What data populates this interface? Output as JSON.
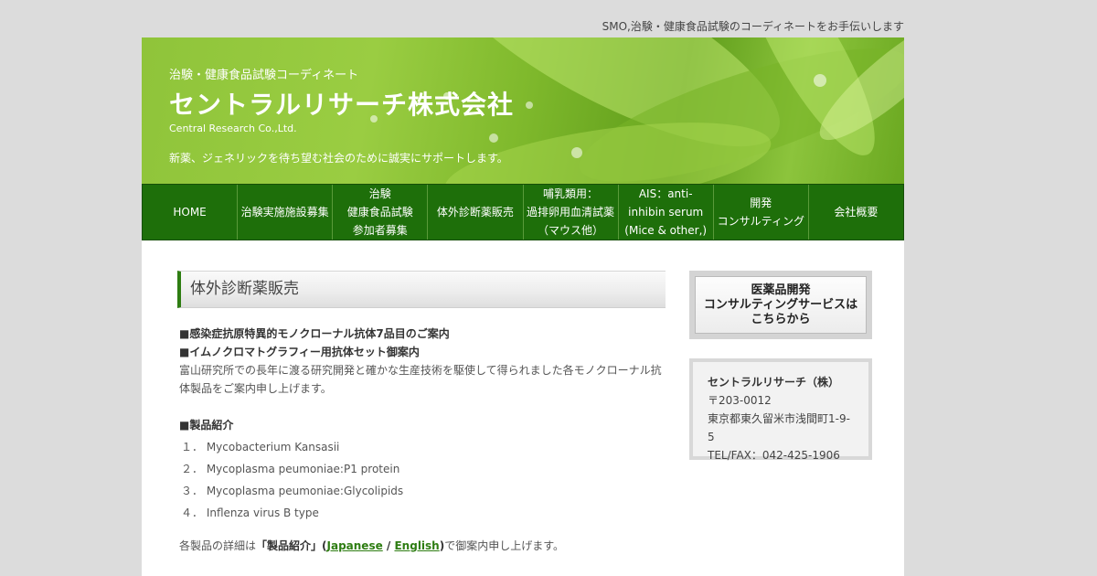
{
  "tagline": "SMO,治験・健康食品試験のコーディネートをお手伝いします",
  "header": {
    "sub": "治験・健康食品試験コーディネート",
    "title": "セントラルリサーチ株式会社",
    "en": "Central Research Co.,Ltd.",
    "message": "新薬、ジェネリックを待ち望む社会のために誠実にサポートします。"
  },
  "nav": [
    {
      "label": "HOME"
    },
    {
      "label": "治験実施施設募集"
    },
    {
      "label": "治験\n健康食品試験\n参加者募集"
    },
    {
      "label": "体外診断薬販売"
    },
    {
      "label": "哺乳類用：\n過排卵用血清試薬\n（マウス他）"
    },
    {
      "label": "AIS：anti-\ninhibin serum\n(Mice & other,)"
    },
    {
      "label": "開発\nコンサルティング"
    },
    {
      "label": "会社概要"
    }
  ],
  "section_title": "体外診断薬販売",
  "content": {
    "heading1": "■感染症抗原特異的モノクローナル抗体7品目のご案内",
    "heading2": "■イムノクロマトグラフィー用抗体セット御案内",
    "intro": "富山研究所での長年に渡る研究開発と確かな生産技術を駆使して得られました各モノクローナル抗体製品をご案内申し上げます。",
    "products_heading": "■製品紹介",
    "products": [
      "１． Mycobacterium Kansasii",
      "２． Mycoplasma peumoniae:P1 protein",
      "３． Mycoplasma peumoniae:Glycolipids",
      "４． Inflenza virus B type"
    ],
    "detail_prefix": "各製品の詳細は",
    "detail_strong": "「製品紹介」",
    "detail_open": "(",
    "detail_link_ja": "Japanese",
    "detail_sep": " / ",
    "detail_link_en": "English",
    "detail_close": ")",
    "detail_suffix": "で御案内申し上げます。"
  },
  "sidebar": {
    "banner": "医薬品開発\nコンサルティングサービスは\nこちらから",
    "company_name": "セントラルリサーチ（株）",
    "postal": "〒203-0012",
    "address": "東京都東久留米市浅間町1-9-5",
    "tel": "TEL/FAX：042-425-1906"
  },
  "colors": {
    "nav_bg": "#1e6f0a",
    "accent": "#2e7d12",
    "page_bg": "#dcdcdc"
  }
}
